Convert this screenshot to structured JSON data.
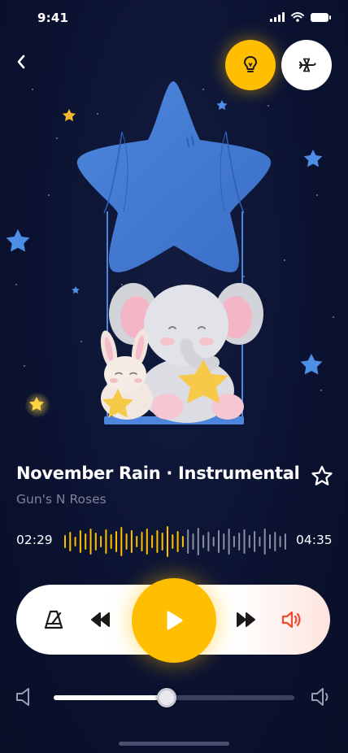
{
  "status_bar": {
    "time": "9:41"
  },
  "track": {
    "title": "November Rain · Instrumental",
    "artist": "Gun's N Roses",
    "elapsed": "02:29",
    "total": "04:35",
    "progress": 0.54
  },
  "volume": {
    "level": 0.47
  },
  "icons": {
    "back": "chevron-left-icon",
    "bulb": "lightbulb-icon",
    "airplane": "airplane-icon",
    "favorite": "star-outline-icon",
    "metronome": "metronome-icon",
    "rewind": "rewind-icon",
    "play": "play-icon",
    "forward": "fast-forward-icon",
    "speaker": "speaker-icon"
  },
  "colors": {
    "accent": "#ffbf00",
    "background": "#0b1230",
    "played_wave": "#ffbf00",
    "unplayed_wave": "#8a8f9f",
    "speaker_accent": "#ef4b2c"
  }
}
